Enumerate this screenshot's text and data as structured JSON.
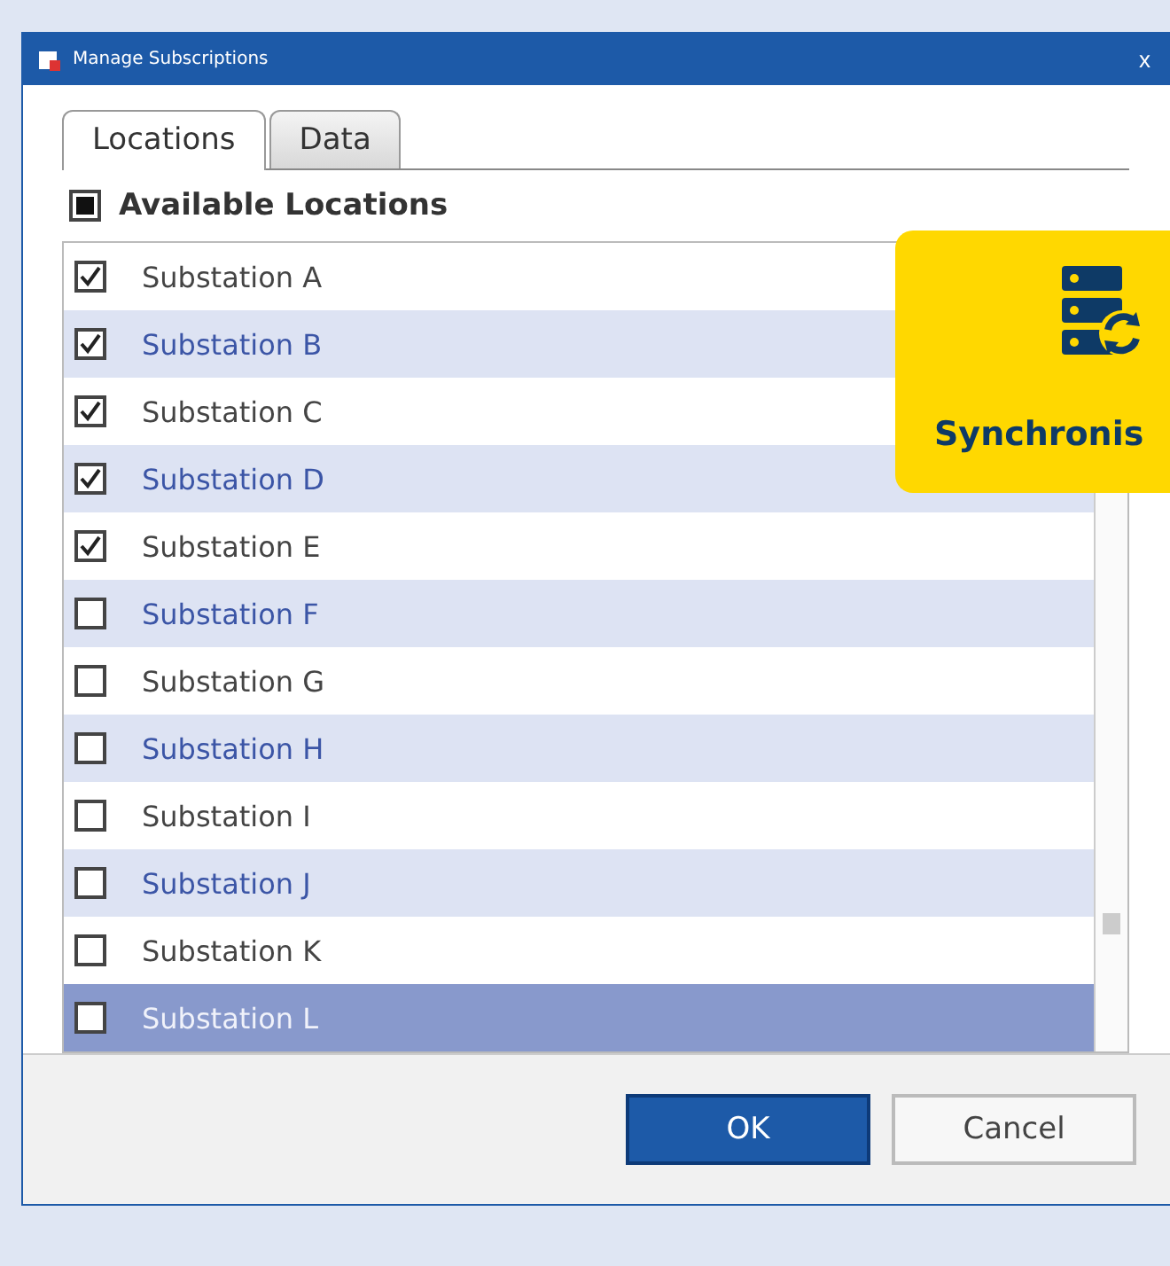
{
  "window": {
    "title": "Manage Subscriptions",
    "close": "x"
  },
  "tabs": [
    {
      "label": "Locations",
      "selected": true
    },
    {
      "label": "Data",
      "selected": false
    }
  ],
  "header": {
    "label": "Available Locations",
    "mixed": true
  },
  "rows": [
    {
      "name": "Substation A",
      "checked": true,
      "selected": false
    },
    {
      "name": "Substation B",
      "checked": true,
      "selected": false
    },
    {
      "name": "Substation C",
      "checked": true,
      "selected": false
    },
    {
      "name": "Substation D",
      "checked": true,
      "selected": false
    },
    {
      "name": "Substation E",
      "checked": true,
      "selected": false
    },
    {
      "name": "Substation F",
      "checked": false,
      "selected": false
    },
    {
      "name": "Substation G",
      "checked": false,
      "selected": false
    },
    {
      "name": "Substation H",
      "checked": false,
      "selected": false
    },
    {
      "name": "Substation I",
      "checked": false,
      "selected": false
    },
    {
      "name": "Substation J",
      "checked": false,
      "selected": false
    },
    {
      "name": "Substation K",
      "checked": false,
      "selected": false
    },
    {
      "name": "Substation L",
      "checked": false,
      "selected": true
    }
  ],
  "buttons": [
    {
      "label": "OK",
      "kind": "primary"
    },
    {
      "label": "Cancel",
      "kind": "secondary"
    }
  ],
  "badge": {
    "label": "Synchronis"
  }
}
